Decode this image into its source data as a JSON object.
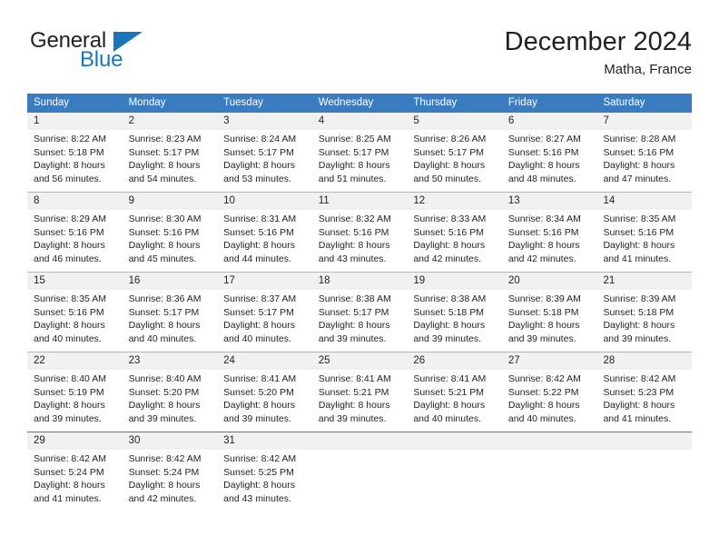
{
  "brand": {
    "name_top": "General",
    "name_bottom": "Blue",
    "triangle_color": "#1b75bb",
    "text_color": "#231f20"
  },
  "header": {
    "title": "December 2024",
    "subtitle": "Matha, France"
  },
  "colors": {
    "header_blue": "#3a7cc0",
    "daynum_band": "#f1f1f1",
    "separator": "#b5b5b5",
    "text": "#231f20"
  },
  "weekdays": [
    "Sunday",
    "Monday",
    "Tuesday",
    "Wednesday",
    "Thursday",
    "Friday",
    "Saturday"
  ],
  "weeks": [
    {
      "separator": "none",
      "days": [
        {
          "num": "1",
          "sunrise": "Sunrise: 8:22 AM",
          "sunset": "Sunset: 5:18 PM",
          "daylight1": "Daylight: 8 hours",
          "daylight2": "and 56 minutes."
        },
        {
          "num": "2",
          "sunrise": "Sunrise: 8:23 AM",
          "sunset": "Sunset: 5:17 PM",
          "daylight1": "Daylight: 8 hours",
          "daylight2": "and 54 minutes."
        },
        {
          "num": "3",
          "sunrise": "Sunrise: 8:24 AM",
          "sunset": "Sunset: 5:17 PM",
          "daylight1": "Daylight: 8 hours",
          "daylight2": "and 53 minutes."
        },
        {
          "num": "4",
          "sunrise": "Sunrise: 8:25 AM",
          "sunset": "Sunset: 5:17 PM",
          "daylight1": "Daylight: 8 hours",
          "daylight2": "and 51 minutes."
        },
        {
          "num": "5",
          "sunrise": "Sunrise: 8:26 AM",
          "sunset": "Sunset: 5:17 PM",
          "daylight1": "Daylight: 8 hours",
          "daylight2": "and 50 minutes."
        },
        {
          "num": "6",
          "sunrise": "Sunrise: 8:27 AM",
          "sunset": "Sunset: 5:16 PM",
          "daylight1": "Daylight: 8 hours",
          "daylight2": "and 48 minutes."
        },
        {
          "num": "7",
          "sunrise": "Sunrise: 8:28 AM",
          "sunset": "Sunset: 5:16 PM",
          "daylight1": "Daylight: 8 hours",
          "daylight2": "and 47 minutes."
        }
      ]
    },
    {
      "separator": "gray",
      "days": [
        {
          "num": "8",
          "sunrise": "Sunrise: 8:29 AM",
          "sunset": "Sunset: 5:16 PM",
          "daylight1": "Daylight: 8 hours",
          "daylight2": "and 46 minutes."
        },
        {
          "num": "9",
          "sunrise": "Sunrise: 8:30 AM",
          "sunset": "Sunset: 5:16 PM",
          "daylight1": "Daylight: 8 hours",
          "daylight2": "and 45 minutes."
        },
        {
          "num": "10",
          "sunrise": "Sunrise: 8:31 AM",
          "sunset": "Sunset: 5:16 PM",
          "daylight1": "Daylight: 8 hours",
          "daylight2": "and 44 minutes."
        },
        {
          "num": "11",
          "sunrise": "Sunrise: 8:32 AM",
          "sunset": "Sunset: 5:16 PM",
          "daylight1": "Daylight: 8 hours",
          "daylight2": "and 43 minutes."
        },
        {
          "num": "12",
          "sunrise": "Sunrise: 8:33 AM",
          "sunset": "Sunset: 5:16 PM",
          "daylight1": "Daylight: 8 hours",
          "daylight2": "and 42 minutes."
        },
        {
          "num": "13",
          "sunrise": "Sunrise: 8:34 AM",
          "sunset": "Sunset: 5:16 PM",
          "daylight1": "Daylight: 8 hours",
          "daylight2": "and 42 minutes."
        },
        {
          "num": "14",
          "sunrise": "Sunrise: 8:35 AM",
          "sunset": "Sunset: 5:16 PM",
          "daylight1": "Daylight: 8 hours",
          "daylight2": "and 41 minutes."
        }
      ]
    },
    {
      "separator": "gray",
      "days": [
        {
          "num": "15",
          "sunrise": "Sunrise: 8:35 AM",
          "sunset": "Sunset: 5:16 PM",
          "daylight1": "Daylight: 8 hours",
          "daylight2": "and 40 minutes."
        },
        {
          "num": "16",
          "sunrise": "Sunrise: 8:36 AM",
          "sunset": "Sunset: 5:17 PM",
          "daylight1": "Daylight: 8 hours",
          "daylight2": "and 40 minutes."
        },
        {
          "num": "17",
          "sunrise": "Sunrise: 8:37 AM",
          "sunset": "Sunset: 5:17 PM",
          "daylight1": "Daylight: 8 hours",
          "daylight2": "and 40 minutes."
        },
        {
          "num": "18",
          "sunrise": "Sunrise: 8:38 AM",
          "sunset": "Sunset: 5:17 PM",
          "daylight1": "Daylight: 8 hours",
          "daylight2": "and 39 minutes."
        },
        {
          "num": "19",
          "sunrise": "Sunrise: 8:38 AM",
          "sunset": "Sunset: 5:18 PM",
          "daylight1": "Daylight: 8 hours",
          "daylight2": "and 39 minutes."
        },
        {
          "num": "20",
          "sunrise": "Sunrise: 8:39 AM",
          "sunset": "Sunset: 5:18 PM",
          "daylight1": "Daylight: 8 hours",
          "daylight2": "and 39 minutes."
        },
        {
          "num": "21",
          "sunrise": "Sunrise: 8:39 AM",
          "sunset": "Sunset: 5:18 PM",
          "daylight1": "Daylight: 8 hours",
          "daylight2": "and 39 minutes."
        }
      ]
    },
    {
      "separator": "gray",
      "days": [
        {
          "num": "22",
          "sunrise": "Sunrise: 8:40 AM",
          "sunset": "Sunset: 5:19 PM",
          "daylight1": "Daylight: 8 hours",
          "daylight2": "and 39 minutes."
        },
        {
          "num": "23",
          "sunrise": "Sunrise: 8:40 AM",
          "sunset": "Sunset: 5:20 PM",
          "daylight1": "Daylight: 8 hours",
          "daylight2": "and 39 minutes."
        },
        {
          "num": "24",
          "sunrise": "Sunrise: 8:41 AM",
          "sunset": "Sunset: 5:20 PM",
          "daylight1": "Daylight: 8 hours",
          "daylight2": "and 39 minutes."
        },
        {
          "num": "25",
          "sunrise": "Sunrise: 8:41 AM",
          "sunset": "Sunset: 5:21 PM",
          "daylight1": "Daylight: 8 hours",
          "daylight2": "and 39 minutes."
        },
        {
          "num": "26",
          "sunrise": "Sunrise: 8:41 AM",
          "sunset": "Sunset: 5:21 PM",
          "daylight1": "Daylight: 8 hours",
          "daylight2": "and 40 minutes."
        },
        {
          "num": "27",
          "sunrise": "Sunrise: 8:42 AM",
          "sunset": "Sunset: 5:22 PM",
          "daylight1": "Daylight: 8 hours",
          "daylight2": "and 40 minutes."
        },
        {
          "num": "28",
          "sunrise": "Sunrise: 8:42 AM",
          "sunset": "Sunset: 5:23 PM",
          "daylight1": "Daylight: 8 hours",
          "daylight2": "and 41 minutes."
        }
      ]
    },
    {
      "separator": "blue",
      "days": [
        {
          "num": "29",
          "sunrise": "Sunrise: 8:42 AM",
          "sunset": "Sunset: 5:24 PM",
          "daylight1": "Daylight: 8 hours",
          "daylight2": "and 41 minutes."
        },
        {
          "num": "30",
          "sunrise": "Sunrise: 8:42 AM",
          "sunset": "Sunset: 5:24 PM",
          "daylight1": "Daylight: 8 hours",
          "daylight2": "and 42 minutes."
        },
        {
          "num": "31",
          "sunrise": "Sunrise: 8:42 AM",
          "sunset": "Sunset: 5:25 PM",
          "daylight1": "Daylight: 8 hours",
          "daylight2": "and 43 minutes."
        },
        {
          "num": "",
          "sunrise": "",
          "sunset": "",
          "daylight1": "",
          "daylight2": ""
        },
        {
          "num": "",
          "sunrise": "",
          "sunset": "",
          "daylight1": "",
          "daylight2": ""
        },
        {
          "num": "",
          "sunrise": "",
          "sunset": "",
          "daylight1": "",
          "daylight2": ""
        },
        {
          "num": "",
          "sunrise": "",
          "sunset": "",
          "daylight1": "",
          "daylight2": ""
        }
      ]
    }
  ]
}
